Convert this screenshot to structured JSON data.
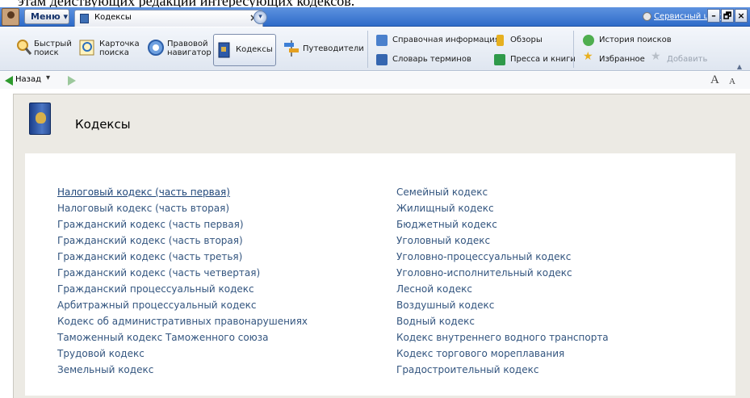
{
  "caption": "этам действующих редакций интересующих кодексов.",
  "titlebar": {
    "menu_label": "Меню ▾",
    "tab_label": "Кодексы",
    "tab_close": "×",
    "newtab_glyph": "▾",
    "service_link": "Сервисный центр",
    "win_buttons": [
      "–",
      "🗗",
      "×"
    ]
  },
  "ribbon": {
    "quick_search": "Быстрый поиск",
    "card_search": "Карточка поиска",
    "legal_navigator": "Правовой навигатор",
    "codes": "Кодексы",
    "guides": "Путеводители",
    "reference_info": "Справочная информация",
    "dictionary": "Словарь терминов",
    "reviews": "Обзоры",
    "press_books": "Пресса и книги",
    "search_history": "История поисков",
    "favorites": "Избранное",
    "add": "Добавить",
    "collapse_glyph": "▲"
  },
  "navbar": {
    "back_label": "Назад",
    "back_dropdown": "▾",
    "font_increase": "A",
    "font_decrease": "A"
  },
  "page": {
    "title": "Кодексы",
    "left_column": [
      "Налоговый кодекс (часть первая)",
      "Налоговый кодекс (часть вторая)",
      "Гражданский кодекс (часть первая)",
      "Гражданский кодекс (часть вторая)",
      "Гражданский кодекс (часть третья)",
      "Гражданский кодекс (часть четвертая)",
      "Гражданский процессуальный кодекс",
      "Арбитражный процессуальный кодекс",
      "Кодекс об административных правонарушениях",
      "Таможенный кодекс Таможенного союза",
      "Трудовой кодекс",
      "Земельный кодекс"
    ],
    "right_column": [
      "Семейный кодекс",
      "Жилищный кодекс",
      "Бюджетный кодекс",
      "Уголовный кодекс",
      "Уголовно-процессуальный кодекс",
      "Уголовно-исполнительный кодекс",
      "Лесной кодекс",
      "Воздушный кодекс",
      "Водный кодекс",
      "Кодекс внутреннего водного транспорта",
      "Кодекс торгового мореплавания",
      "Градостроительный кодекс"
    ]
  },
  "colors": {
    "link": "#33557f",
    "title_bar": "#2e6bc9",
    "content_bg": "#eceae4"
  }
}
